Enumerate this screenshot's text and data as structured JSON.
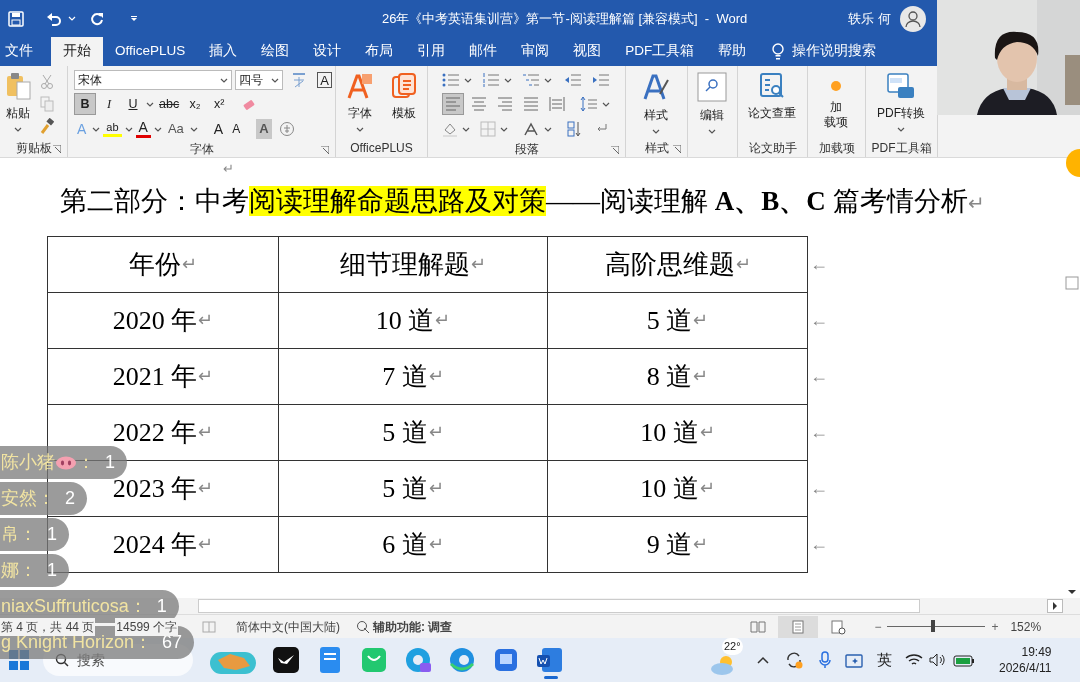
{
  "title_bar": {
    "title": "26年《中考英语集训营》第一节-阅读理解篇 [兼容模式]  -  Word",
    "user": "轶乐 何"
  },
  "tabs": [
    {
      "label": "文件",
      "selected": false
    },
    {
      "label": "开始",
      "selected": true
    },
    {
      "label": "OfficePLUS",
      "selected": false
    },
    {
      "label": "插入",
      "selected": false
    },
    {
      "label": "绘图",
      "selected": false
    },
    {
      "label": "设计",
      "selected": false
    },
    {
      "label": "布局",
      "selected": false
    },
    {
      "label": "引用",
      "selected": false
    },
    {
      "label": "邮件",
      "selected": false
    },
    {
      "label": "审阅",
      "selected": false
    },
    {
      "label": "视图",
      "selected": false
    },
    {
      "label": "PDF工具箱",
      "selected": false
    },
    {
      "label": "帮助",
      "selected": false
    }
  ],
  "tell_me": "操作说明搜索",
  "ribbon": {
    "clipboard": {
      "paste": "粘贴",
      "group": "剪贴板"
    },
    "font": {
      "name": "宋体",
      "size": "四号",
      "char_border": "A",
      "styles": [
        {
          "label": "B",
          "selected": true
        },
        {
          "label": "I",
          "selected": false
        },
        {
          "label": "U",
          "selected": false
        },
        {
          "label": "abc",
          "selected": false
        },
        {
          "label": "x₂",
          "selected": false
        },
        {
          "label": "x²",
          "selected": false
        }
      ],
      "effects": [
        {
          "kind": "text-effect",
          "label": "A"
        },
        {
          "kind": "highlight",
          "label": "ab"
        },
        {
          "kind": "font-color",
          "label": "A"
        },
        {
          "kind": "case",
          "label": "Aa"
        },
        {
          "kind": "grow",
          "label": "A"
        },
        {
          "kind": "shrink",
          "label": "A"
        },
        {
          "kind": "shading",
          "label": "A"
        }
      ],
      "group": "字体"
    },
    "officeplus": {
      "buttons": [
        "字体",
        "模板"
      ],
      "group": "OfficePLUS"
    },
    "paragraph": {
      "align": [
        {
          "selected": true
        },
        {
          "selected": false
        },
        {
          "selected": false
        },
        {
          "selected": false
        },
        {
          "selected": false
        }
      ],
      "group": "段落"
    },
    "styles": {
      "button": "样式",
      "group": "样式"
    },
    "editing": {
      "button": "编辑"
    },
    "paper": {
      "button": "论文查重",
      "group": "论文助手"
    },
    "addins": {
      "button": [
        "加",
        "载项"
      ],
      "group": "加载项"
    },
    "pdf": {
      "button": "PDF转换",
      "group": "PDF工具箱"
    }
  },
  "document": {
    "empty_mark": "↵",
    "heading": [
      {
        "text": "第二部分：中考",
        "highlight": false
      },
      {
        "text": "阅读理解命题思路及对策",
        "highlight": true
      },
      {
        "text": "——阅读理解 **A、B、C** 篇考情分析",
        "highlight": false
      }
    ],
    "heading_mark": "↵",
    "table": {
      "rows": [
        {
          "cells": [
            {
              "text": "年份",
              "mark": "↵"
            },
            {
              "text": "细节理解题",
              "mark": "↵"
            },
            {
              "text": "高阶思维题",
              "mark": "↵"
            }
          ],
          "end_mark": "←"
        },
        {
          "cells": [
            {
              "text": "2020 年",
              "mark": "↵"
            },
            {
              "text": "10 道",
              "mark": "↵"
            },
            {
              "text": "5 道",
              "mark": "↵"
            }
          ],
          "end_mark": "←"
        },
        {
          "cells": [
            {
              "text": "2021 年",
              "mark": "↵"
            },
            {
              "text": "7 道",
              "mark": "↵"
            },
            {
              "text": "8 道",
              "mark": "↵"
            }
          ],
          "end_mark": "←"
        },
        {
          "cells": [
            {
              "text": "2022 年",
              "mark": "↵"
            },
            {
              "text": "5 道",
              "mark": "↵"
            },
            {
              "text": "10 道",
              "mark": "↵"
            }
          ],
          "end_mark": "←"
        },
        {
          "cells": [
            {
              "text": "2023 年",
              "mark": "↵"
            },
            {
              "text": "5 道",
              "mark": "↵"
            },
            {
              "text": "10 道",
              "mark": "↵"
            }
          ],
          "end_mark": "←"
        },
        {
          "cells": [
            {
              "text": "2024 年",
              "mark": "↵"
            },
            {
              "text": "6 道",
              "mark": "↵"
            },
            {
              "text": "9 道",
              "mark": "↵"
            }
          ],
          "end_mark": "←"
        }
      ]
    }
  },
  "status_bar": {
    "page": "第 4 页，共 44 页",
    "words": "14599 个字",
    "language": "简体中文(中国大陆)",
    "accessibility": "辅助功能: 调查",
    "views": [
      {
        "selected": false
      },
      {
        "selected": true
      },
      {
        "selected": false
      }
    ],
    "zoom": {
      "minus": "−",
      "plus": "+",
      "level": 0.46,
      "percent": "152%"
    }
  },
  "taskbar": {
    "search": "搜索",
    "weather": "22°",
    "ime": "英",
    "time": "19:49",
    "date": "2026/4/11"
  },
  "chat": [
    {
      "name": "陈小猪",
      "emoji": true,
      "suffix": "：",
      "count": "1"
    },
    {
      "name": "安然：",
      "emoji": false,
      "count": "2"
    },
    {
      "name": "帛：",
      "emoji": false,
      "count": "1"
    },
    {
      "name": "娜：",
      "emoji": false,
      "count": "1"
    },
    {
      "name": "niaxSuffruticosa：",
      "emoji": false,
      "count": "1"
    },
    {
      "name": "g Knight Horizon：",
      "emoji": false,
      "count": "67"
    }
  ]
}
